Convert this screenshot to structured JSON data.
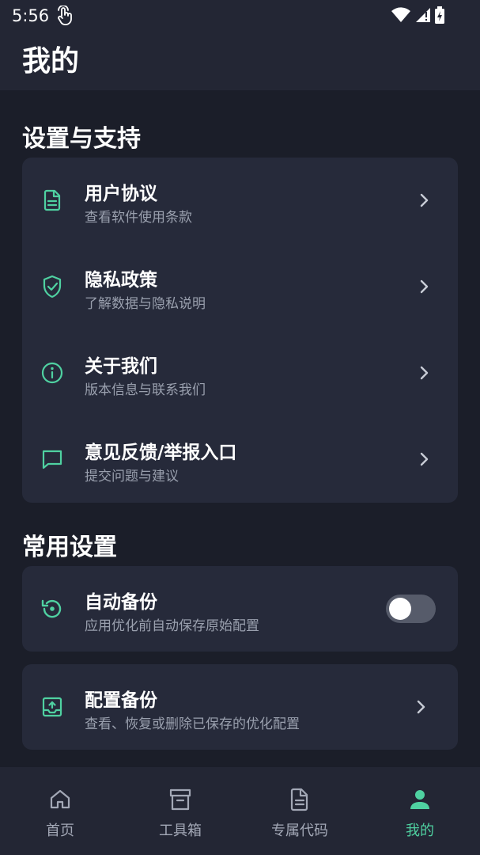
{
  "status_bar": {
    "time": "5:56"
  },
  "header": {
    "title": "我的"
  },
  "sections": {
    "support": {
      "title": "设置与支持",
      "items": [
        {
          "title": "用户协议",
          "subtitle": "查看软件使用条款",
          "icon": "document-icon"
        },
        {
          "title": "隐私政策",
          "subtitle": "了解数据与隐私说明",
          "icon": "shield-check-icon"
        },
        {
          "title": "关于我们",
          "subtitle": "版本信息与联系我们",
          "icon": "info-icon"
        },
        {
          "title": "意见反馈/举报入口",
          "subtitle": "提交问题与建议",
          "icon": "message-icon"
        }
      ]
    },
    "common": {
      "title": "常用设置",
      "auto_backup": {
        "title": "自动备份",
        "subtitle": "应用优化前自动保存原始配置",
        "enabled": false,
        "icon": "restore-icon"
      },
      "config_backup": {
        "title": "配置备份",
        "subtitle": "查看、恢复或删除已保存的优化配置",
        "icon": "upload-box-icon"
      }
    }
  },
  "bottom_nav": {
    "items": [
      {
        "label": "首页",
        "icon": "home-icon"
      },
      {
        "label": "工具箱",
        "icon": "archive-box-icon"
      },
      {
        "label": "专属代码",
        "icon": "file-text-icon"
      },
      {
        "label": "我的",
        "icon": "person-icon",
        "active": true
      }
    ]
  },
  "colors": {
    "background": "#1b1e29",
    "card": "#262a3a",
    "accent": "#4fd1a1",
    "subtitle": "#9aa0ae"
  }
}
